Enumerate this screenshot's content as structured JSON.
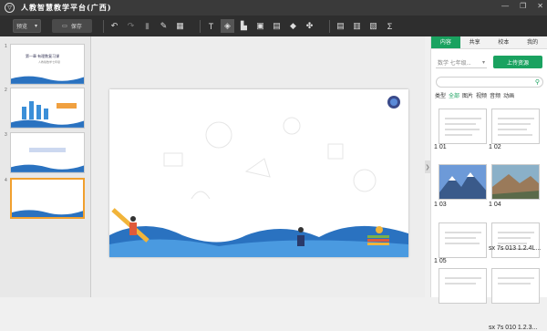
{
  "app": {
    "title": "人教智慧教学平台(广西)",
    "window_controls": [
      "—",
      "❐",
      "✕"
    ]
  },
  "toolbar": {
    "preview_label": "预览",
    "save_label": "保存",
    "icons": [
      "undo-icon",
      "redo-icon",
      "trash-icon",
      "brush-icon",
      "paint-icon",
      "text-icon",
      "layers-icon",
      "shapes-icon",
      "image-icon",
      "table-icon",
      "eraser-icon",
      "puzzle-icon",
      "page-icon",
      "document-icon",
      "exam-icon",
      "formula-icon"
    ]
  },
  "slides": [
    {
      "num": "1",
      "title": "第一章 有理数复习课",
      "subtitle": "人教版数学七年级",
      "selected": false
    },
    {
      "num": "2",
      "selected": false
    },
    {
      "num": "3",
      "selected": false
    },
    {
      "num": "4",
      "selected": true
    }
  ],
  "panel": {
    "tabs": [
      "内容",
      "共享",
      "校本",
      "我的"
    ],
    "active_tab": 0,
    "grade_select": "数学 七年级...",
    "upload_label": "上传资源",
    "search_placeholder": "",
    "filters": [
      "类型",
      "全部",
      "图片",
      "视频",
      "音频",
      "动画"
    ],
    "active_filter": 1,
    "resources": [
      {
        "label": "1 01"
      },
      {
        "label": "1 02"
      },
      {
        "label": "1 03"
      },
      {
        "label": "1 04"
      },
      {
        "label": "1 05"
      },
      {
        "label": "sx 7s 013 1.2.4L..."
      },
      {
        "label": ""
      },
      {
        "label": "sx 7s 010 1.2.3..."
      }
    ]
  },
  "colors": {
    "accent": "#1aa260",
    "wave": "#2a72c0",
    "selection": "#f1a02e"
  }
}
